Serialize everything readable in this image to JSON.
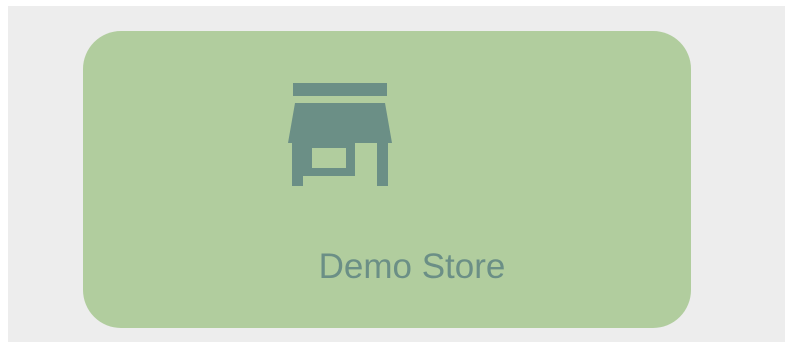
{
  "store_card": {
    "label": "Demo Store",
    "icon": "storefront-icon"
  },
  "colors": {
    "page_background": "#ededed",
    "card_background": "#b1cd9e",
    "accent": "#6b8f86"
  }
}
